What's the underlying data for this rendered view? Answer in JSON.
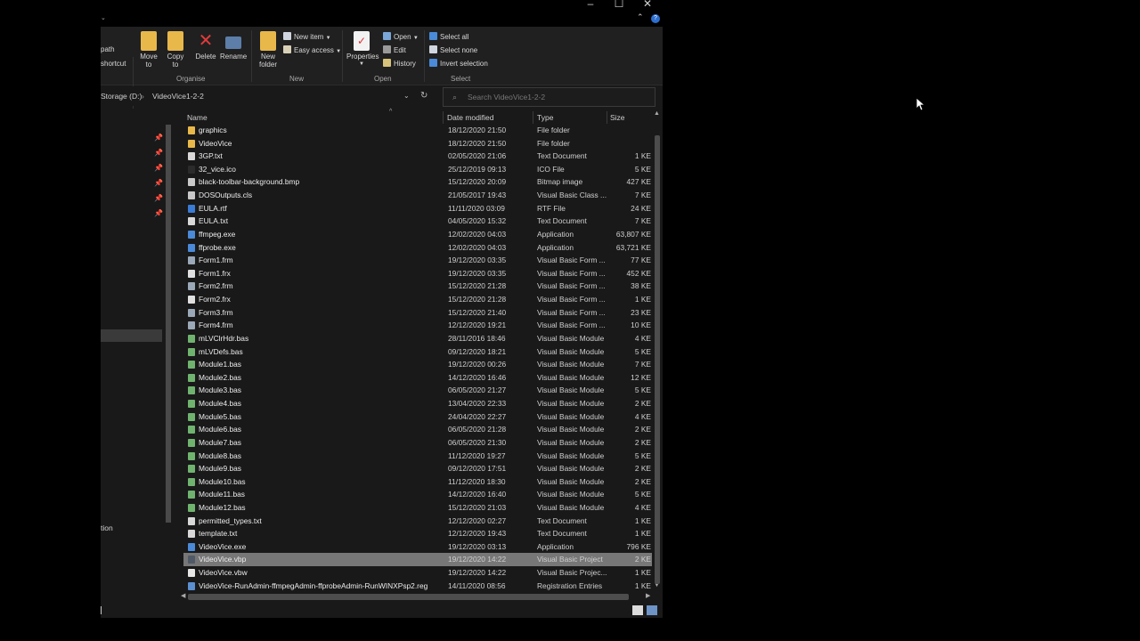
{
  "ribbon": {
    "left_partial": {
      "line1": "path",
      "line2": "shortcut"
    },
    "organise": {
      "move_to": [
        "Move",
        "to"
      ],
      "copy_to": [
        "Copy",
        "to"
      ],
      "delete": "Delete",
      "rename": "Rename",
      "label": "Organise"
    },
    "new": {
      "new_folder": [
        "New",
        "folder"
      ],
      "new_item": "New item",
      "easy_access": "Easy access",
      "label": "New"
    },
    "open": {
      "properties": "Properties",
      "open": "Open",
      "edit": "Edit",
      "history": "History",
      "label": "Open"
    },
    "select": {
      "select_all": "Select all",
      "select_none": "Select none",
      "invert_selection": "Invert selection",
      "label": "Select"
    }
  },
  "address": {
    "drive": "Storage (D:)",
    "separator": "›",
    "folder": "VideoVice1-2-2"
  },
  "search": {
    "placeholder": "Search VideoVice1-2-2"
  },
  "nav": {
    "partial_label": "tion"
  },
  "columns": {
    "name": "Name",
    "date": "Date modified",
    "type": "Type",
    "size": "Size"
  },
  "files": [
    {
      "name": "graphics",
      "date": "18/12/2020 21:50",
      "type": "File folder",
      "size": "",
      "icon": "folder-icon"
    },
    {
      "name": "VideoVice",
      "date": "18/12/2020 21:50",
      "type": "File folder",
      "size": "",
      "icon": "folder-icon"
    },
    {
      "name": "3GP.txt",
      "date": "02/05/2020 21:06",
      "type": "Text Document",
      "size": "1 KE",
      "icon": "text-file-icon"
    },
    {
      "name": "32_vice.ico",
      "date": "25/12/2019 09:13",
      "type": "ICO File",
      "size": "5 KE",
      "icon": "ico-file-icon"
    },
    {
      "name": "black-toolbar-background.bmp",
      "date": "15/12/2020 20:09",
      "type": "Bitmap image",
      "size": "427 KE",
      "icon": "image-file-icon"
    },
    {
      "name": "DOSOutputs.cls",
      "date": "21/05/2017 19:43",
      "type": "Visual Basic Class ...",
      "size": "7 KE",
      "icon": "vb-class-icon"
    },
    {
      "name": "EULA.rtf",
      "date": "11/11/2020 03:09",
      "type": "RTF File",
      "size": "24 KE",
      "icon": "rtf-file-icon"
    },
    {
      "name": "EULA.txt",
      "date": "04/05/2020 15:32",
      "type": "Text Document",
      "size": "7 KE",
      "icon": "text-file-icon"
    },
    {
      "name": "ffmpeg.exe",
      "date": "12/02/2020 04:03",
      "type": "Application",
      "size": "63,807 KE",
      "icon": "app-icon"
    },
    {
      "name": "ffprobe.exe",
      "date": "12/02/2020 04:03",
      "type": "Application",
      "size": "63,721 KE",
      "icon": "app-icon"
    },
    {
      "name": "Form1.frm",
      "date": "19/12/2020 03:35",
      "type": "Visual Basic Form ...",
      "size": "77 KE",
      "icon": "vb-form-icon"
    },
    {
      "name": "Form1.frx",
      "date": "19/12/2020 03:35",
      "type": "Visual Basic Form ...",
      "size": "452 KE",
      "icon": "vb-form-binary-icon"
    },
    {
      "name": "Form2.frm",
      "date": "15/12/2020 21:28",
      "type": "Visual Basic Form ...",
      "size": "38 KE",
      "icon": "vb-form-icon"
    },
    {
      "name": "Form2.frx",
      "date": "15/12/2020 21:28",
      "type": "Visual Basic Form ...",
      "size": "1 KE",
      "icon": "vb-form-binary-icon"
    },
    {
      "name": "Form3.frm",
      "date": "15/12/2020 21:40",
      "type": "Visual Basic Form ...",
      "size": "23 KE",
      "icon": "vb-form-icon"
    },
    {
      "name": "Form4.frm",
      "date": "12/12/2020 19:21",
      "type": "Visual Basic Form ...",
      "size": "10 KE",
      "icon": "vb-form-icon"
    },
    {
      "name": "mLVClrHdr.bas",
      "date": "28/11/2016 18:46",
      "type": "Visual Basic Module",
      "size": "4 KE",
      "icon": "vb-module-icon"
    },
    {
      "name": "mLVDefs.bas",
      "date": "09/12/2020 18:21",
      "type": "Visual Basic Module",
      "size": "5 KE",
      "icon": "vb-module-icon"
    },
    {
      "name": "Module1.bas",
      "date": "19/12/2020 00:26",
      "type": "Visual Basic Module",
      "size": "7 KE",
      "icon": "vb-module-icon"
    },
    {
      "name": "Module2.bas",
      "date": "14/12/2020 16:46",
      "type": "Visual Basic Module",
      "size": "12 KE",
      "icon": "vb-module-icon"
    },
    {
      "name": "Module3.bas",
      "date": "06/05/2020 21:27",
      "type": "Visual Basic Module",
      "size": "5 KE",
      "icon": "vb-module-icon"
    },
    {
      "name": "Module4.bas",
      "date": "13/04/2020 22:33",
      "type": "Visual Basic Module",
      "size": "2 KE",
      "icon": "vb-module-icon"
    },
    {
      "name": "Module5.bas",
      "date": "24/04/2020 22:27",
      "type": "Visual Basic Module",
      "size": "4 KE",
      "icon": "vb-module-icon"
    },
    {
      "name": "Module6.bas",
      "date": "06/05/2020 21:28",
      "type": "Visual Basic Module",
      "size": "2 KE",
      "icon": "vb-module-icon"
    },
    {
      "name": "Module7.bas",
      "date": "06/05/2020 21:30",
      "type": "Visual Basic Module",
      "size": "2 KE",
      "icon": "vb-module-icon"
    },
    {
      "name": "Module8.bas",
      "date": "11/12/2020 19:27",
      "type": "Visual Basic Module",
      "size": "5 KE",
      "icon": "vb-module-icon"
    },
    {
      "name": "Module9.bas",
      "date": "09/12/2020 17:51",
      "type": "Visual Basic Module",
      "size": "2 KE",
      "icon": "vb-module-icon"
    },
    {
      "name": "Module10.bas",
      "date": "11/12/2020 18:30",
      "type": "Visual Basic Module",
      "size": "2 KE",
      "icon": "vb-module-icon"
    },
    {
      "name": "Module11.bas",
      "date": "14/12/2020 16:40",
      "type": "Visual Basic Module",
      "size": "5 KE",
      "icon": "vb-module-icon"
    },
    {
      "name": "Module12.bas",
      "date": "15/12/2020 21:03",
      "type": "Visual Basic Module",
      "size": "4 KE",
      "icon": "vb-module-icon"
    },
    {
      "name": "permitted_types.txt",
      "date": "12/12/2020 02:27",
      "type": "Text Document",
      "size": "1 KE",
      "icon": "text-file-icon"
    },
    {
      "name": "template.txt",
      "date": "12/12/2020 19:43",
      "type": "Text Document",
      "size": "1 KE",
      "icon": "text-file-icon"
    },
    {
      "name": "VideoVice.exe",
      "date": "19/12/2020 03:13",
      "type": "Application",
      "size": "796 KE",
      "icon": "app-icon"
    },
    {
      "name": "VideoVice.vbp",
      "date": "19/12/2020 14:22",
      "type": "Visual Basic Project",
      "size": "2 KE",
      "icon": "vb-project-icon",
      "selected": true
    },
    {
      "name": "VideoVice.vbw",
      "date": "19/12/2020 14:22",
      "type": "Visual Basic Projec...",
      "size": "1 KE",
      "icon": "vb-workspace-icon"
    },
    {
      "name": "VideoVice-RunAdmin-ffmpegAdmin-ffprobeAdmin-RunWINXPsp2.reg",
      "date": "14/11/2020 08:56",
      "type": "Registration Entries",
      "size": "1 KE",
      "icon": "registry-file-icon"
    }
  ],
  "icon_colors": {
    "folder-icon": "#e8b84a",
    "text-file-icon": "#d8d8d8",
    "ico-file-icon": "#2b2b2b",
    "image-file-icon": "#c9c9c9",
    "vb-class-icon": "#c8c8c8",
    "rtf-file-icon": "#3a7bd5",
    "app-icon": "#4a8ad8",
    "vb-form-icon": "#9aa8b8",
    "vb-form-binary-icon": "#e0e0e0",
    "vb-module-icon": "#6fb36f",
    "vb-project-icon": "#505a66",
    "vb-workspace-icon": "#e6e6e6",
    "registry-file-icon": "#5b8fd0"
  }
}
